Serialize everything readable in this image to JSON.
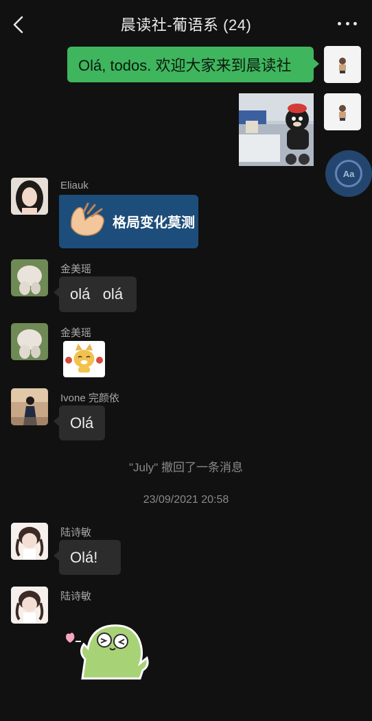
{
  "header": {
    "title": "晨读社-葡语系 (24)"
  },
  "messages": [
    {
      "side": "right",
      "text": "Olá, todos. 欢迎大家来到晨读社"
    },
    {
      "side": "right",
      "type": "image"
    },
    {
      "side": "left",
      "sender": "Eliauk",
      "sticker_text": "格局变化莫测"
    },
    {
      "side": "left",
      "sender": "金美瑶",
      "text": "olá   olá"
    },
    {
      "side": "left",
      "sender": "金美瑶",
      "type": "sticker"
    },
    {
      "side": "left",
      "sender": "Ivone 完颜依",
      "text": "Olá"
    },
    {
      "side": "left",
      "sender": "陆诗敏",
      "text": "Olá!"
    },
    {
      "side": "left",
      "sender": "陆诗敏",
      "type": "sticker"
    }
  ],
  "system": {
    "recall_notice": "\"July\" 撤回了一条消息",
    "timestamp": "23/09/2021 20:58"
  },
  "translate_button": {
    "label": "Aa"
  },
  "colors": {
    "background": "#111111",
    "bubble_left": "#2c2c2c",
    "bubble_right": "#3fb55e",
    "translate_button": "#24466e"
  },
  "icons": [
    "back-arrow-icon",
    "more-dots-icon",
    "translate-icon"
  ]
}
